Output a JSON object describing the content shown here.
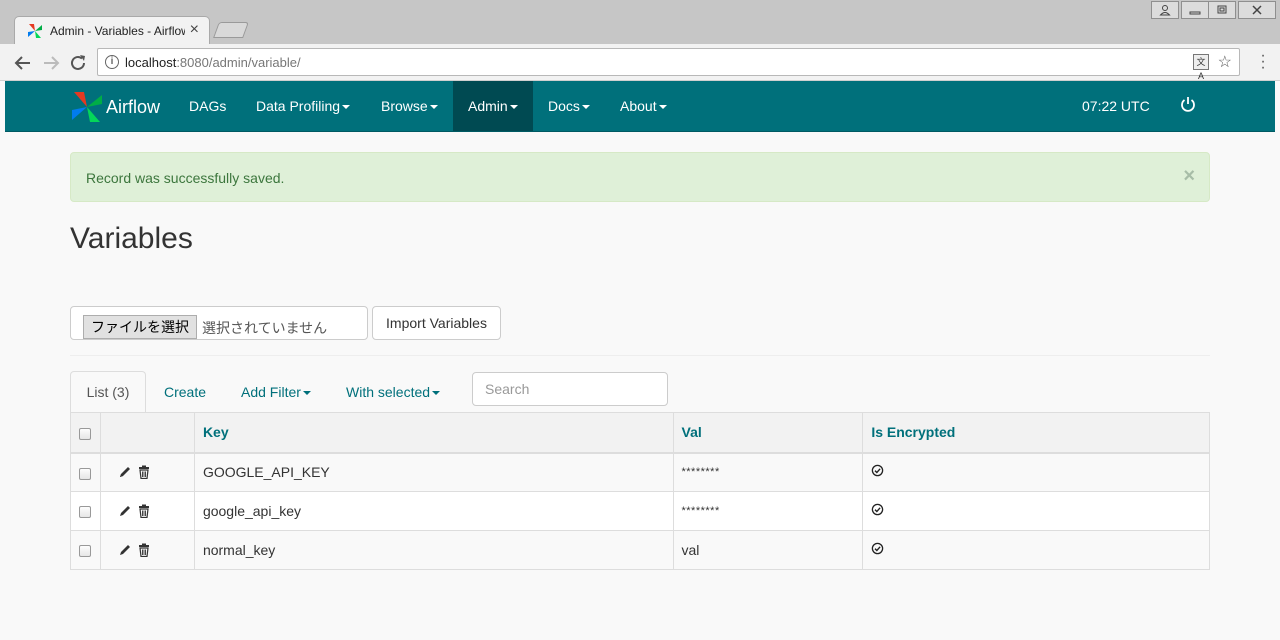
{
  "browser": {
    "tab_title": "Admin - Variables - Airflow",
    "tab_close": "×",
    "url_host": "localhost",
    "url_path": ":8080/admin/variable/",
    "translate_glyph": "文A"
  },
  "navbar": {
    "brand": "Airflow",
    "items": [
      {
        "label": "DAGs"
      },
      {
        "label": "Data Profiling"
      },
      {
        "label": "Browse"
      },
      {
        "label": "Admin"
      },
      {
        "label": "Docs"
      },
      {
        "label": "About"
      }
    ],
    "active": "Admin",
    "clock": "07:22 UTC"
  },
  "alert": {
    "message": "Record was successfully saved.",
    "close": "×"
  },
  "page": {
    "title": "Variables",
    "file_button": "ファイルを選択",
    "file_status": "選択されていません",
    "import_button": "Import Variables"
  },
  "list_tabs": {
    "list": "List (3)",
    "create": "Create",
    "add_filter": "Add Filter",
    "with_selected": "With selected",
    "search_placeholder": "Search"
  },
  "table": {
    "columns": [
      "Key",
      "Val",
      "Is Encrypted"
    ],
    "rows": [
      {
        "key": "GOOGLE_API_KEY",
        "val": "********",
        "encrypted": true
      },
      {
        "key": "google_api_key",
        "val": "********",
        "encrypted": true
      },
      {
        "key": "normal_key",
        "val": "val",
        "encrypted": true
      }
    ]
  },
  "colors": {
    "navbar": "#00707b",
    "navbar_active": "#004a52",
    "link": "#00707b",
    "alert_bg": "#dff0d8",
    "alert_text": "#3c763d"
  }
}
